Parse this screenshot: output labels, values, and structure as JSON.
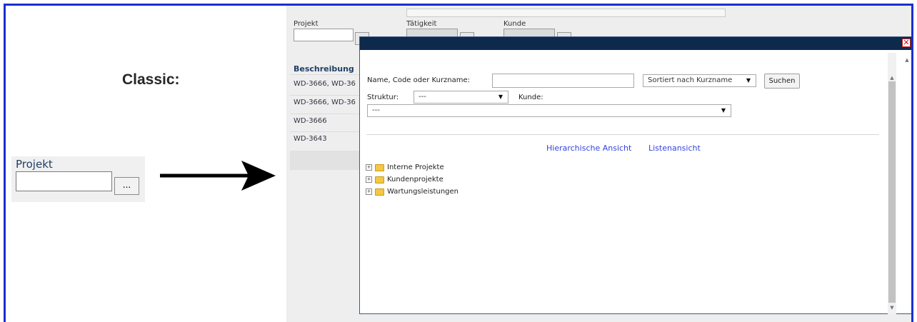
{
  "classic": {
    "title": "Classic:",
    "field_label": "Projekt",
    "input_value": "",
    "button_label": "..."
  },
  "background_form": {
    "projekt_label": "Projekt",
    "taetigkeit_label": "Tätigkeit",
    "kunde_label": "Kunde",
    "table_header": "Beschreibung",
    "rows": [
      "WD-3666, WD-36",
      "WD-3666, WD-36",
      "WD-3666",
      "WD-3643"
    ]
  },
  "dialog": {
    "close_symbol": "✕",
    "search_label": "Name, Code oder Kurzname:",
    "search_value": "",
    "sort_value": "Sortiert nach Kurzname",
    "search_button": "Suchen",
    "struktur_label": "Struktur:",
    "struktur_value": "---",
    "kunde_label": "Kunde:",
    "kunde_value": "---",
    "view_links": [
      "Hierarchische Ansicht",
      "Listenansicht"
    ],
    "tree": [
      "Interne Projekte",
      "Kundenprojekte",
      "Wartungsleistungen"
    ]
  },
  "colors": {
    "frame_border": "#1b2fd0",
    "dialog_titlebar": "#0d2a4d",
    "link": "#3344dd"
  },
  "icons": [
    "arrow-right-icon",
    "close-icon",
    "dropdown-caret-icon",
    "expand-plus-icon",
    "folder-icon",
    "scroll-up-icon",
    "scroll-down-icon"
  ]
}
